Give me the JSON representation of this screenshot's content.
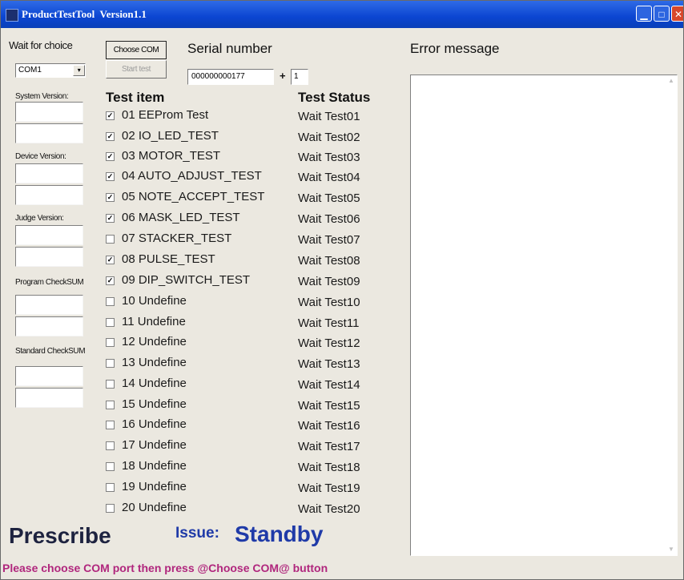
{
  "window": {
    "title": "ProductTestTool  Version1.1"
  },
  "left": {
    "wait_label": "Wait for choice",
    "com_value": "COM1",
    "choose_com": "Choose COM",
    "start_test": "Start test",
    "system_version": "System Version:",
    "device_version": "Device Version:",
    "judge_version": "Judge  Version:",
    "program_checksum": "Program CheckSUM",
    "standard_checksum": "Standard CheckSUM"
  },
  "serial": {
    "label": "Serial number",
    "value": "000000000177",
    "plus": "+",
    "increment": "1"
  },
  "headers": {
    "item": "Test item",
    "status": "Test Status",
    "error": "Error message"
  },
  "tests": [
    {
      "name": "01 EEProm Test",
      "status": "Wait Test01",
      "checked": true
    },
    {
      "name": "02 IO_LED_TEST",
      "status": "Wait Test02",
      "checked": true
    },
    {
      "name": "03 MOTOR_TEST",
      "status": "Wait Test03",
      "checked": true
    },
    {
      "name": "04 AUTO_ADJUST_TEST",
      "status": "Wait Test04",
      "checked": true
    },
    {
      "name": "05 NOTE_ACCEPT_TEST",
      "status": "Wait Test05",
      "checked": true
    },
    {
      "name": "06 MASK_LED_TEST",
      "status": "Wait Test06",
      "checked": true
    },
    {
      "name": "07 STACKER_TEST",
      "status": "Wait Test07",
      "checked": false
    },
    {
      "name": "08 PULSE_TEST",
      "status": "Wait Test08",
      "checked": true
    },
    {
      "name": "09 DIP_SWITCH_TEST",
      "status": "Wait Test09",
      "checked": true
    },
    {
      "name": "10 Undefine",
      "status": "Wait Test10",
      "checked": false
    },
    {
      "name": "11 Undefine",
      "status": "Wait Test11",
      "checked": false
    },
    {
      "name": "12 Undefine",
      "status": "Wait Test12",
      "checked": false
    },
    {
      "name": "13 Undefine",
      "status": "Wait Test13",
      "checked": false
    },
    {
      "name": "14 Undefine",
      "status": "Wait Test14",
      "checked": false
    },
    {
      "name": "15 Undefine",
      "status": "Wait Test15",
      "checked": false
    },
    {
      "name": "16 Undefine",
      "status": "Wait Test16",
      "checked": false
    },
    {
      "name": "17 Undefine",
      "status": "Wait Test17",
      "checked": false
    },
    {
      "name": "18 Undefine",
      "status": "Wait Test18",
      "checked": false
    },
    {
      "name": "19 Undefine",
      "status": "Wait Test19",
      "checked": false
    },
    {
      "name": "20 Undefine",
      "status": "Wait Test20",
      "checked": false
    }
  ],
  "bottom": {
    "prescribe": "Prescribe",
    "issue_label": "Issue:",
    "issue_value": "Standby",
    "footer": "Please choose COM port then press @Choose COM@ button"
  },
  "colors": {
    "titlebar": "#0b45d1",
    "issue": "#1f3aa8",
    "footer": "#b0267d"
  },
  "icons": {
    "minimize": "minimize-icon",
    "maximize": "maximize-icon",
    "close": "close-icon",
    "dropdown": "chevron-down-icon"
  }
}
